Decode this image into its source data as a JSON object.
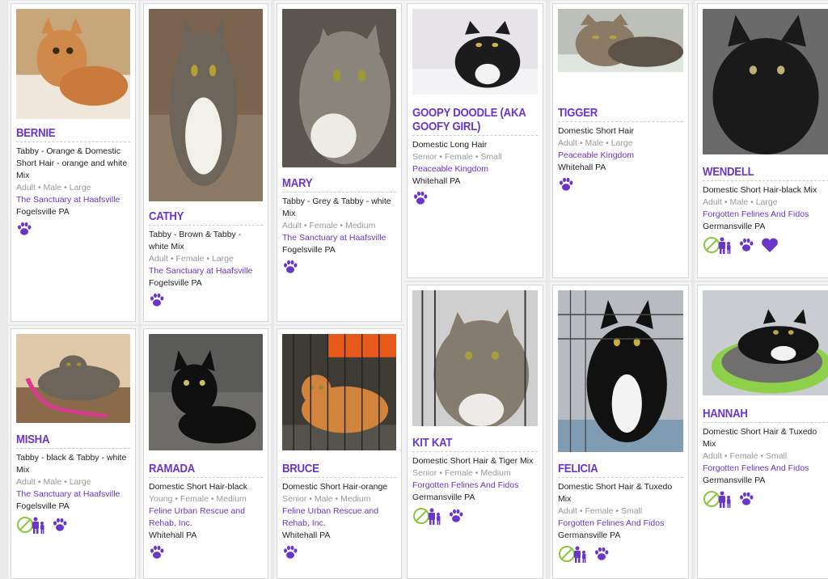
{
  "colors": {
    "accent": "#6a35c9",
    "good_with": "#8cc63f",
    "meta_gray": "#999999"
  },
  "pets": [
    {
      "name": "BERNIE",
      "breed": "Tabby - Orange & Domestic Short Hair - orange and white Mix",
      "meta": "Adult • Male • Large",
      "org": "The Sanctuary at Haafsville",
      "location": "Fogelsville PA",
      "icons": [
        "paw-icon"
      ],
      "photo": "orange tabby cat"
    },
    {
      "name": "CATHY",
      "breed": "Tabby - Brown & Tabby - white Mix",
      "meta": "Adult • Female • Large",
      "org": "The Sanctuary at Haafsville",
      "location": "Fogelsville PA",
      "icons": [
        "paw-icon"
      ],
      "photo": "brown and white tabby cat"
    },
    {
      "name": "MARY",
      "breed": "Tabby - Grey & Tabby - white Mix",
      "meta": "Adult • Female • Medium",
      "org": "The Sanctuary at Haafsville",
      "location": "Fogelsville PA",
      "icons": [
        "paw-icon"
      ],
      "photo": "grey tabby cat"
    },
    {
      "name": "GOOPY DOODLE (AKA GOOFY GIRL)",
      "breed": "Domestic Long Hair",
      "meta": "Senior • Female • Small",
      "org": "Peaceable Kingdom",
      "location": "Whitehall PA",
      "icons": [
        "paw-icon"
      ],
      "photo": "black and white cat"
    },
    {
      "name": "TIGGER",
      "breed": "Domestic Short Hair",
      "meta": "Adult • Male • Large",
      "org": "Peaceable Kingdom",
      "location": "Whitehall PA",
      "icons": [
        "paw-icon"
      ],
      "photo": "tabby cat"
    },
    {
      "name": "WENDELL",
      "breed": "Domestic Short Hair-black Mix",
      "meta": "Adult • Male • Large",
      "org": "Forgotten Felines And Fidos",
      "location": "Germansville PA",
      "icons": [
        "good-with-kids-icon",
        "paw-icon",
        "heart-icon"
      ],
      "photo": "black cat"
    },
    {
      "name": "MISHA",
      "breed": "Tabby - black & Tabby - white Mix",
      "meta": "Adult • Male • Large",
      "org": "The Sanctuary at Haafsville",
      "location": "Fogelsville PA",
      "icons": [
        "good-with-kids-icon",
        "paw-icon"
      ],
      "photo": "tabby cat with toy"
    },
    {
      "name": "RAMADA",
      "breed": "Domestic Short Hair-black",
      "meta": "Young • Female • Medium",
      "org": "Feline Urban Rescue and Rehab, Inc.",
      "location": "Whitehall PA",
      "icons": [
        "paw-icon"
      ],
      "photo": "black cat on pavement"
    },
    {
      "name": "BRUCE",
      "breed": "Domestic Short Hair-orange",
      "meta": "Senior • Male • Medium",
      "org": "Feline Urban Rescue and Rehab, Inc.",
      "location": "Whitehall PA",
      "icons": [
        "paw-icon"
      ],
      "photo": "orange cat in crate"
    },
    {
      "name": "KIT KAT",
      "breed": "Domestic Short Hair & Tiger Mix",
      "meta": "Senior • Female • Medium",
      "org": "Forgotten Felines And Fidos",
      "location": "Germansville PA",
      "icons": [
        "good-with-kids-icon",
        "paw-icon"
      ],
      "photo": "grey tabby cat in cage"
    },
    {
      "name": "FELICIA",
      "breed": "Domestic Short Hair & Tuxedo Mix",
      "meta": "Adult • Female • Small",
      "org": "Forgotten Felines And Fidos",
      "location": "Germansville PA",
      "icons": [
        "good-with-kids-icon",
        "paw-icon"
      ],
      "photo": "tuxedo cat in cage"
    },
    {
      "name": "HANNAH",
      "breed": "Domestic Short Hair & Tuxedo Mix",
      "meta": "Adult • Female • Small",
      "org": "Forgotten Felines And Fidos",
      "location": "Germansville PA",
      "icons": [
        "good-with-kids-icon",
        "paw-icon"
      ],
      "photo": "tuxedo cat in green bed"
    }
  ]
}
